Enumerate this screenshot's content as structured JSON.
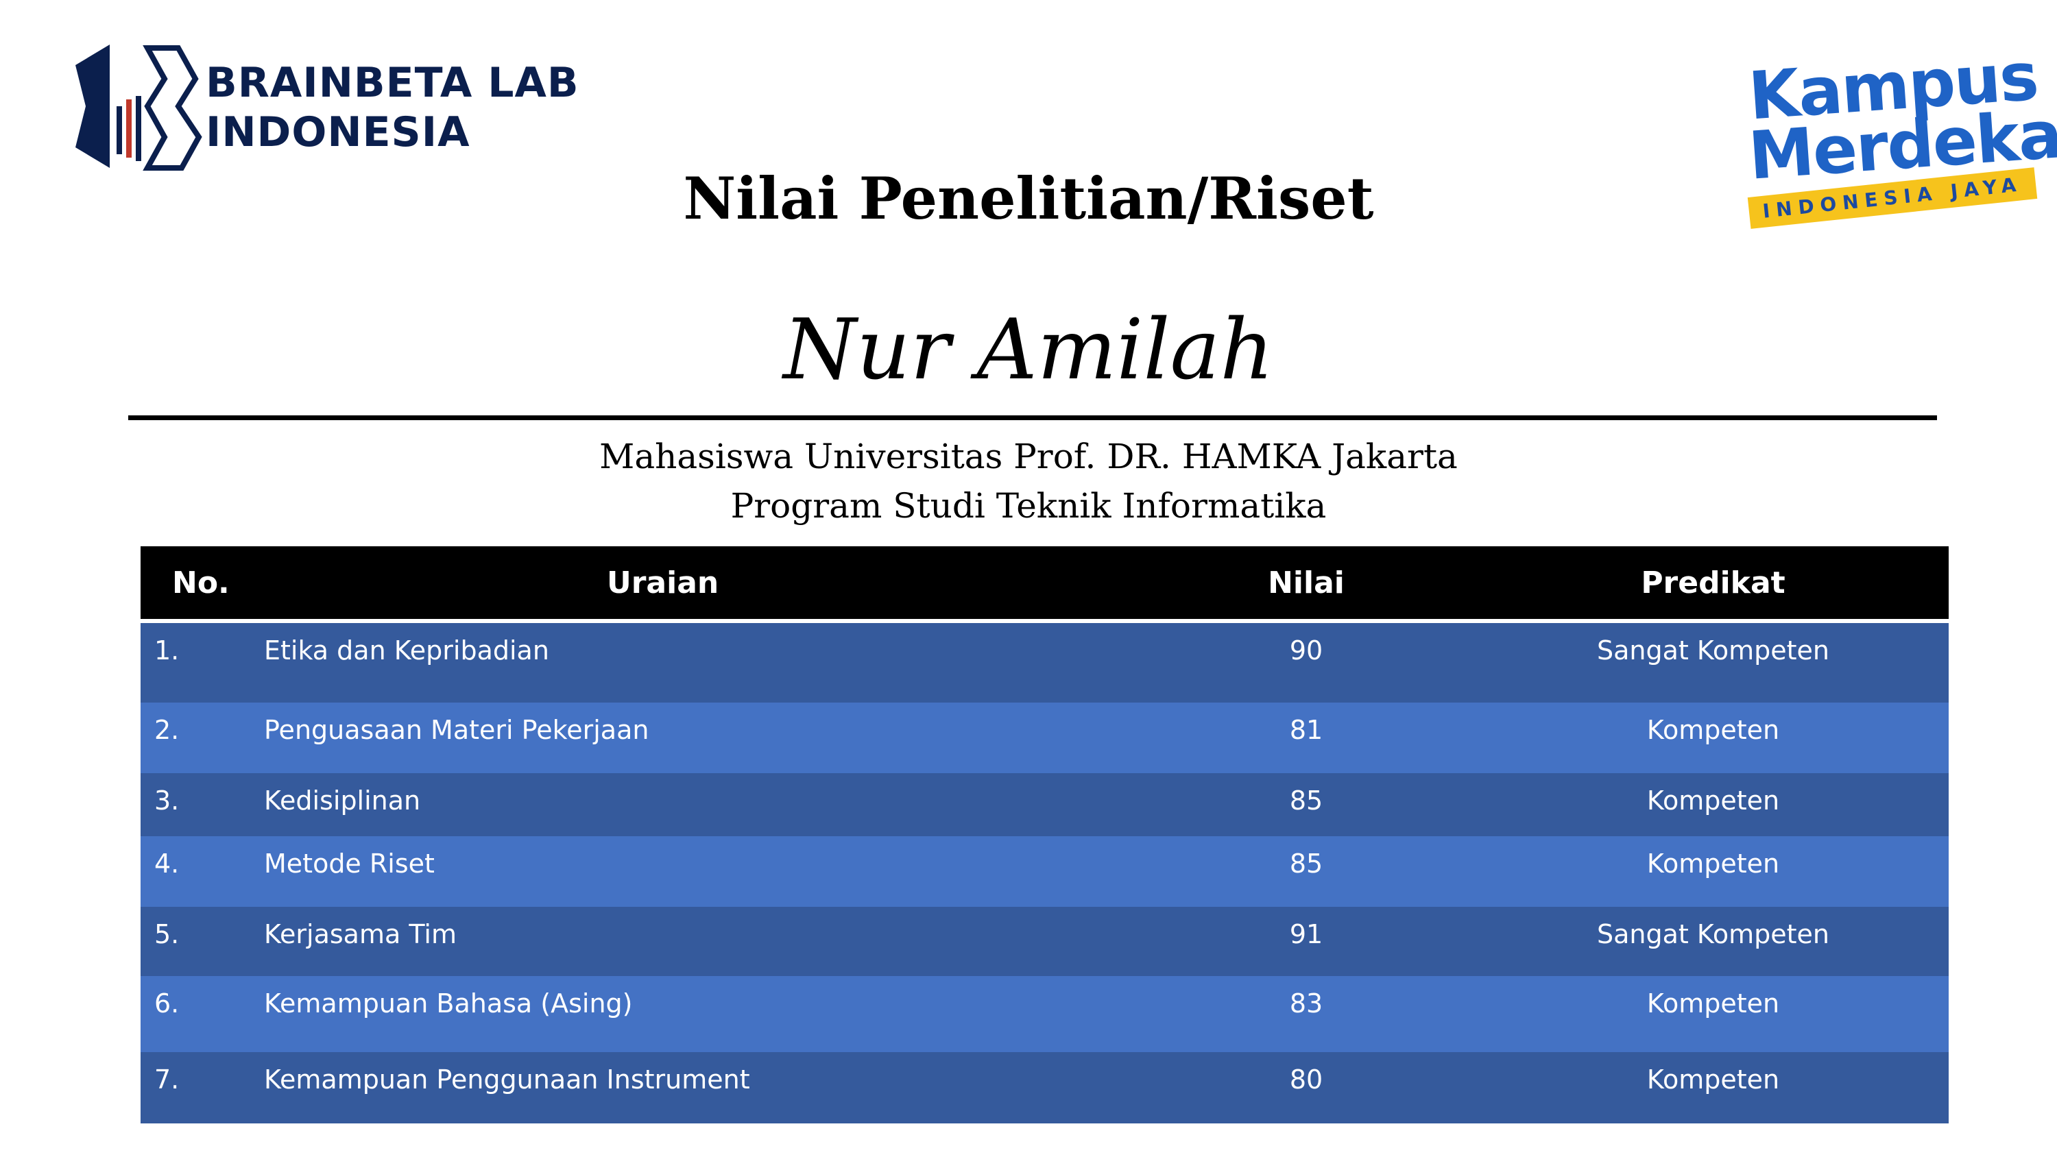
{
  "header": {
    "left_logo": {
      "icon": "brainbeta-logo-icon",
      "line1": "BRAINBETA LAB",
      "line2": "INDONESIA",
      "color": "#0b1f4d"
    },
    "right_logo": {
      "icon": "kampus-merdeka-logo-icon",
      "word1": "Kampus",
      "word2": "Merdeka",
      "ribbon": "INDONESIA JAYA",
      "colors": {
        "primary": "#1f63c6",
        "ribbon": "#f6c31c"
      }
    }
  },
  "title": "Nilai Penelitian/Riset",
  "name": "Nur Amilah",
  "subtitle": {
    "line1": "Mahasiswa Universitas Prof. DR. HAMKA Jakarta",
    "line2": "Program Studi Teknik Informatika"
  },
  "table": {
    "headers": {
      "no": "No.",
      "desc": "Uraian",
      "value": "Nilai",
      "predicate": "Predikat"
    },
    "rows": [
      {
        "no": "1.",
        "desc": "Etika dan Kepribadian",
        "value": "90",
        "predicate": "Sangat Kompeten"
      },
      {
        "no": "2.",
        "desc": "Penguasaan Materi Pekerjaan",
        "value": "81",
        "predicate": "Kompeten"
      },
      {
        "no": "3.",
        "desc": "Kedisiplinan",
        "value": "85",
        "predicate": "Kompeten"
      },
      {
        "no": "4.",
        "desc": "Metode Riset",
        "value": "85",
        "predicate": "Kompeten"
      },
      {
        "no": "5.",
        "desc": "Kerjasama Tim",
        "value": "91",
        "predicate": "Sangat Kompeten"
      },
      {
        "no": "6.",
        "desc": "Kemampuan Bahasa (Asing)",
        "value": "83",
        "predicate": "Kompeten"
      },
      {
        "no": "7.",
        "desc": "Kemampuan Penggunaan Instrument",
        "value": "80",
        "predicate": "Kompeten"
      }
    ],
    "colors": {
      "header_bg": "#000000",
      "row_dark": "#355a9c",
      "row_light": "#4472c4",
      "text": "#ffffff"
    }
  }
}
